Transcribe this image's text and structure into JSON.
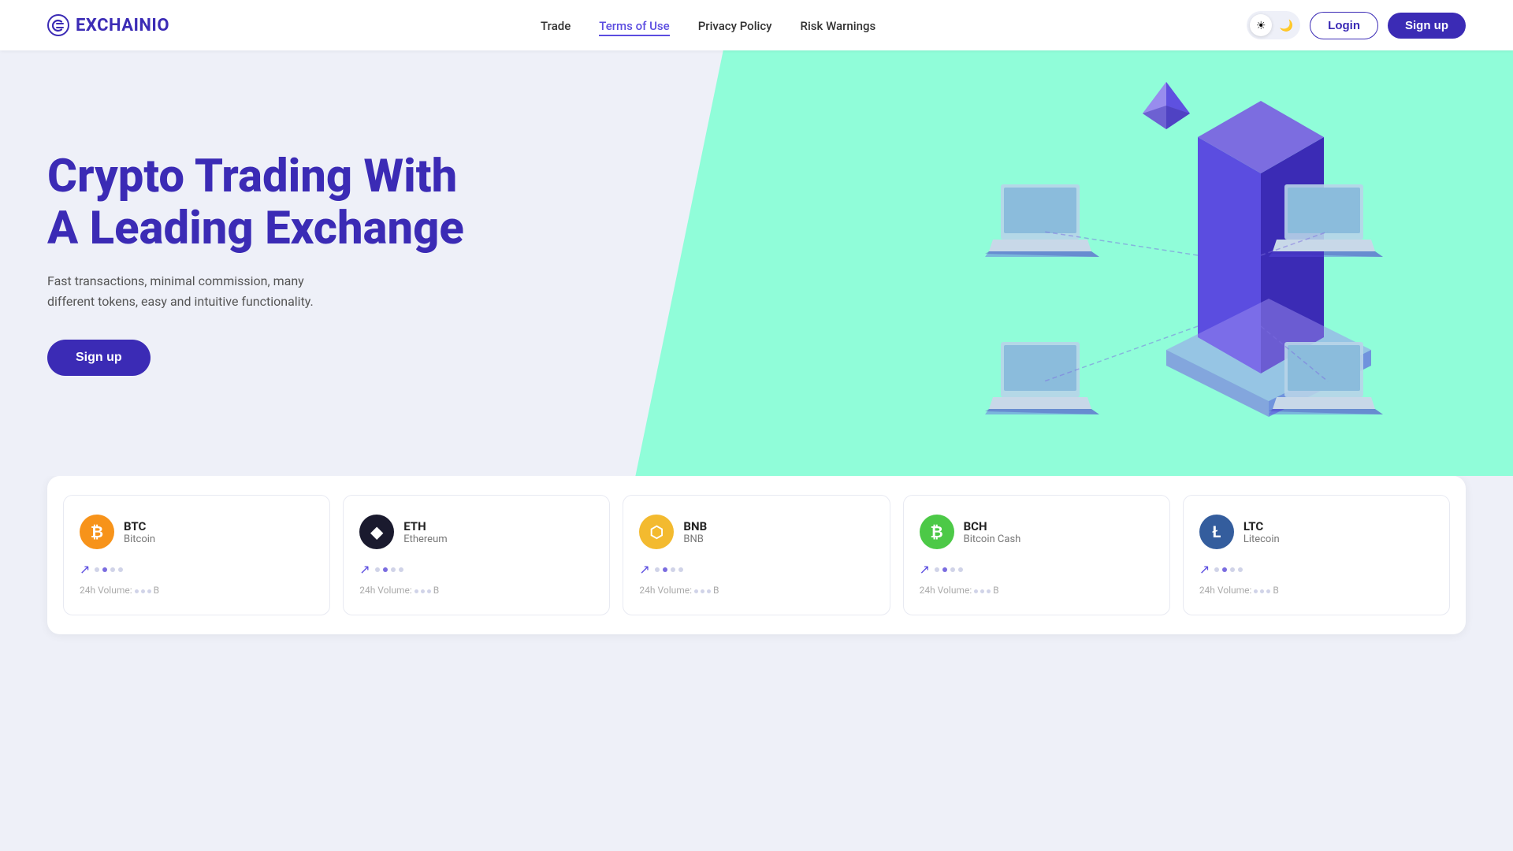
{
  "brand": {
    "name": "EXCHAINIO",
    "logo_symbol": "C"
  },
  "nav": {
    "links": [
      {
        "label": "Trade",
        "active": false
      },
      {
        "label": "Terms of Use",
        "active": true
      },
      {
        "label": "Privacy Policy",
        "active": false
      },
      {
        "label": "Risk Warnings",
        "active": false
      }
    ],
    "login_label": "Login",
    "signup_label": "Sign up"
  },
  "theme": {
    "sun_icon": "☀",
    "moon_icon": "🌙"
  },
  "hero": {
    "title": "Crypto Trading With A Leading Exchange",
    "subtitle": "Fast transactions, minimal commission, many different tokens, easy and intuitive functionality.",
    "cta_label": "Sign up"
  },
  "crypto_cards": [
    {
      "ticker": "BTC",
      "name": "Bitcoin",
      "color_class": "btc",
      "symbol": "₿",
      "volume_label": "24h Volume:",
      "volume_unit": "B"
    },
    {
      "ticker": "ETH",
      "name": "Ethereum",
      "color_class": "eth",
      "symbol": "◆",
      "volume_label": "24h Volume:",
      "volume_unit": "B"
    },
    {
      "ticker": "BNB",
      "name": "BNB",
      "color_class": "bnb",
      "symbol": "⬡",
      "volume_label": "24h Volume:",
      "volume_unit": "B"
    },
    {
      "ticker": "BCH",
      "name": "Bitcoin Cash",
      "color_class": "bch",
      "symbol": "₿",
      "volume_label": "24h Volume:",
      "volume_unit": "B"
    },
    {
      "ticker": "LTC",
      "name": "Litecoin",
      "color_class": "ltc",
      "symbol": "Ł",
      "volume_label": "24h Volume:",
      "volume_unit": "B"
    }
  ]
}
